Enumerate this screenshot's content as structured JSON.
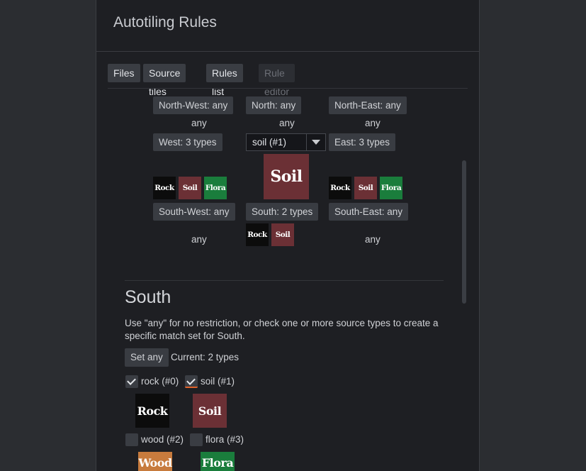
{
  "title": "Autotiling Rules",
  "tabs": [
    {
      "label": "Files",
      "enabled": true
    },
    {
      "label": "Source tiles",
      "enabled": true
    },
    {
      "label": "Rules list",
      "enabled": true
    },
    {
      "label": "Rule editor",
      "enabled": false
    }
  ],
  "grid": {
    "nw": {
      "button": "North-West: any",
      "caption": "any"
    },
    "n": {
      "button": "North: any",
      "caption": "any"
    },
    "ne": {
      "button": "North-East: any",
      "caption": "any"
    },
    "w": {
      "button": "West: 3 types"
    },
    "center": {
      "selected": "soil (#1)"
    },
    "e": {
      "button": "East: 3 types"
    },
    "sw": {
      "button": "South-West: any",
      "caption": "any"
    },
    "s": {
      "button": "South: 2 types"
    },
    "se": {
      "button": "South-East: any",
      "caption": "any"
    }
  },
  "tile_labels": {
    "rock": "Rock",
    "soil": "Soil",
    "flora": "Flora",
    "wood": "Wood"
  },
  "tile_colors": {
    "rock": "#0c0c0c",
    "soil": "#6b3035",
    "flora": "#1a7d3c",
    "wood": "#c77b3d"
  },
  "south": {
    "heading": "South",
    "description": "Use \"any\" for no restriction, or check one or more source types to create a specific match set for South.",
    "set_any": "Set any",
    "current": "Current: 2 types",
    "types": [
      {
        "label": "rock (#0)",
        "checked": true
      },
      {
        "label": "soil (#1)",
        "checked": true
      },
      {
        "label": "wood (#2)",
        "checked": false
      },
      {
        "label": "flora (#3)",
        "checked": false
      }
    ]
  }
}
